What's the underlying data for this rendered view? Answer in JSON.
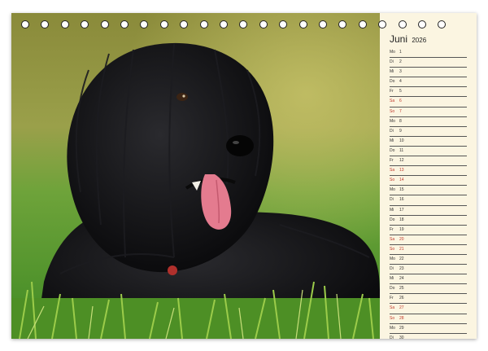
{
  "calendar": {
    "month": "Juni",
    "year": "2026",
    "accent_weekend": "#c0392b",
    "days": [
      {
        "wd": "Mo",
        "n": "1",
        "we": false
      },
      {
        "wd": "Di",
        "n": "2",
        "we": false
      },
      {
        "wd": "Mi",
        "n": "3",
        "we": false
      },
      {
        "wd": "Do",
        "n": "4",
        "we": false
      },
      {
        "wd": "Fr",
        "n": "5",
        "we": false
      },
      {
        "wd": "Sa",
        "n": "6",
        "we": true
      },
      {
        "wd": "So",
        "n": "7",
        "we": true
      },
      {
        "wd": "Mo",
        "n": "8",
        "we": false
      },
      {
        "wd": "Di",
        "n": "9",
        "we": false
      },
      {
        "wd": "Mi",
        "n": "10",
        "we": false
      },
      {
        "wd": "Do",
        "n": "11",
        "we": false
      },
      {
        "wd": "Fr",
        "n": "12",
        "we": false
      },
      {
        "wd": "Sa",
        "n": "13",
        "we": true
      },
      {
        "wd": "So",
        "n": "14",
        "we": true
      },
      {
        "wd": "Mo",
        "n": "15",
        "we": false
      },
      {
        "wd": "Di",
        "n": "16",
        "we": false
      },
      {
        "wd": "Mi",
        "n": "17",
        "we": false
      },
      {
        "wd": "Do",
        "n": "18",
        "we": false
      },
      {
        "wd": "Fr",
        "n": "19",
        "we": false
      },
      {
        "wd": "Sa",
        "n": "20",
        "we": true
      },
      {
        "wd": "So",
        "n": "21",
        "we": true
      },
      {
        "wd": "Mo",
        "n": "22",
        "we": false
      },
      {
        "wd": "Di",
        "n": "23",
        "we": false
      },
      {
        "wd": "Mi",
        "n": "24",
        "we": false
      },
      {
        "wd": "Do",
        "n": "25",
        "we": false
      },
      {
        "wd": "Fr",
        "n": "26",
        "we": false
      },
      {
        "wd": "Sa",
        "n": "27",
        "we": true
      },
      {
        "wd": "So",
        "n": "28",
        "we": true
      },
      {
        "wd": "Mo",
        "n": "29",
        "we": false
      },
      {
        "wd": "Di",
        "n": "30",
        "we": false
      }
    ]
  },
  "binding_rings": 22
}
